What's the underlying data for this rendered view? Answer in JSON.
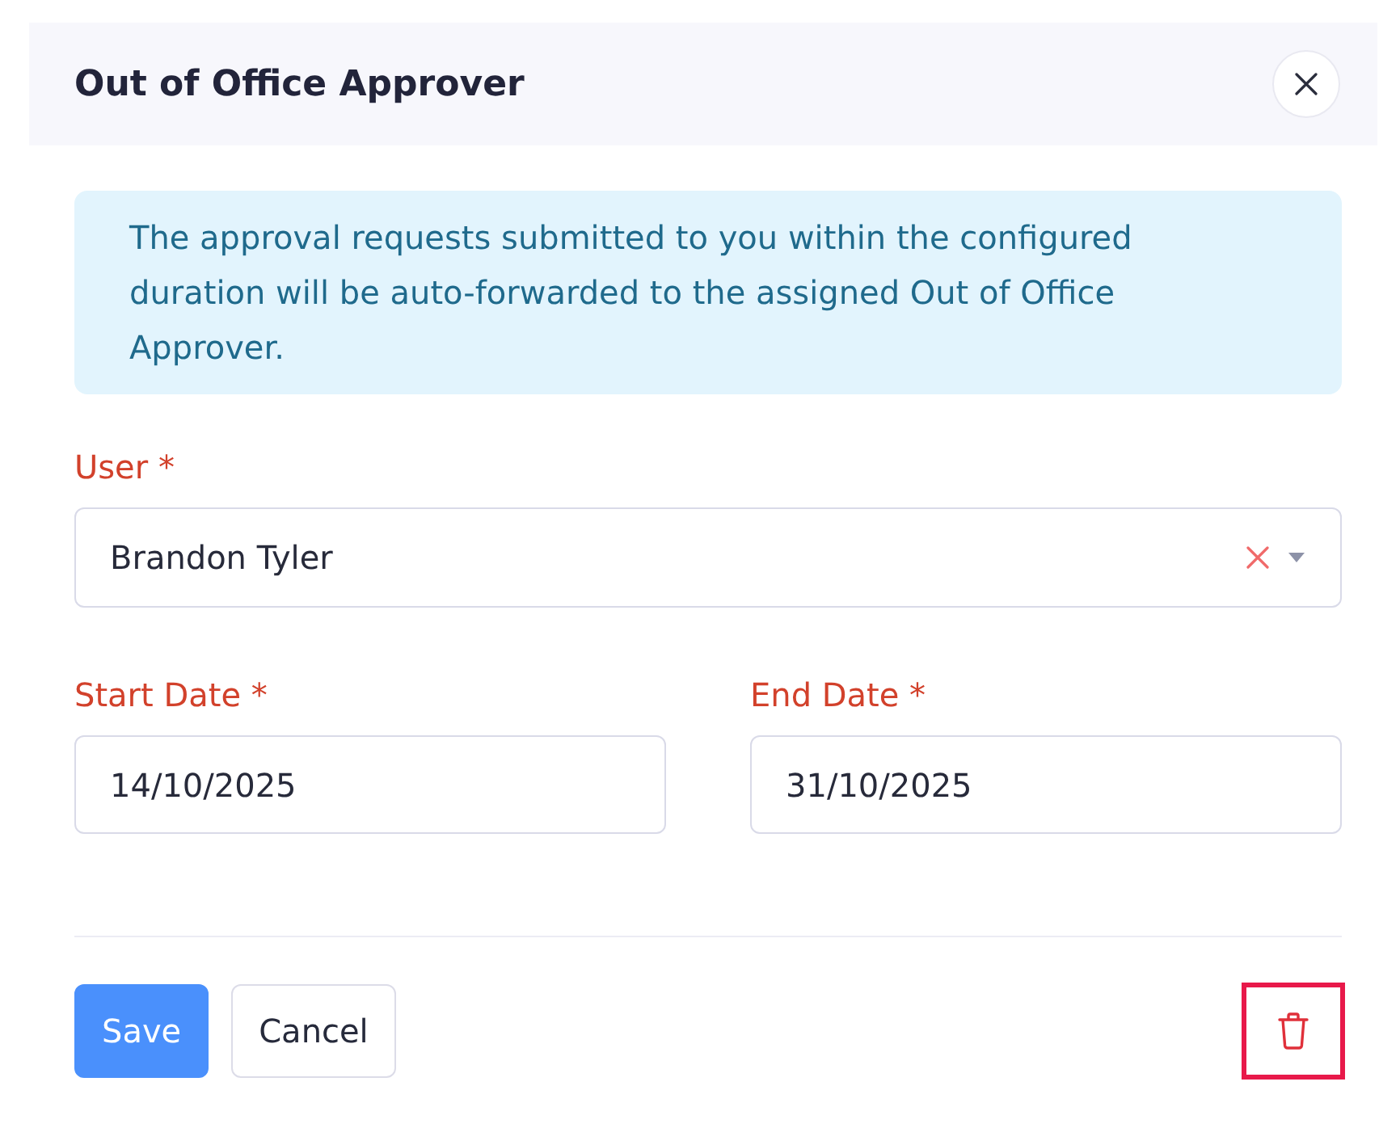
{
  "dialog": {
    "title": "Out of Office Approver"
  },
  "info": "The approval requests submitted to you within the configured duration will be auto-forwarded to the assigned Out of Office Approver.",
  "user_field": {
    "label": "User *",
    "value": "Brandon Tyler"
  },
  "date_fields": [
    {
      "label": "Start Date *",
      "value": "14/10/2025"
    },
    {
      "label": "End Date *",
      "value": "31/10/2025"
    }
  ],
  "buttons": [
    {
      "label": "Save",
      "kind": "primary"
    },
    {
      "label": "Cancel",
      "kind": "secondary"
    }
  ],
  "delete_button": {
    "highlighted": true
  }
}
